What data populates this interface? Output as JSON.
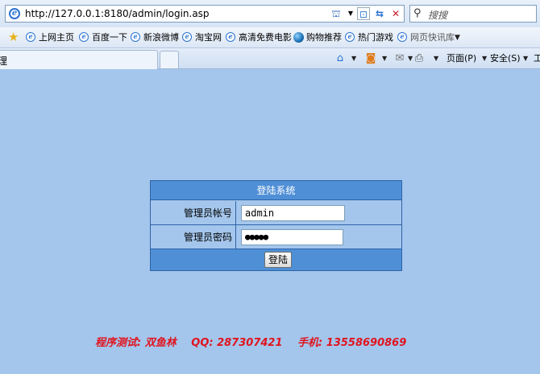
{
  "browser": {
    "url": "http://127.0.0.1:8180/admin/login.asp",
    "search_placeholder": "搜搜",
    "tab_label": "理",
    "favorites": [
      {
        "label": "上网主页",
        "icon": "ie-page-icon"
      },
      {
        "label": "百度一下",
        "icon": "ie-page-icon"
      },
      {
        "label": "新浪微博",
        "icon": "ie-page-icon"
      },
      {
        "label": "淘宝网",
        "icon": "ie-page-icon"
      },
      {
        "label": "高清免费电影",
        "icon": "ie-page-icon"
      },
      {
        "label": "购物推荐",
        "icon": "globe-icon"
      },
      {
        "label": "热门游戏",
        "icon": "ie-page-icon"
      },
      {
        "label": "网页快讯库",
        "icon": "ie-page-icon"
      }
    ],
    "commands": {
      "page": "页面(P)",
      "safety": "安全(S)",
      "tools": "工"
    }
  },
  "login": {
    "title": "登陆系统",
    "username_label": "管理员帐号",
    "username_value": "admin",
    "password_label": "管理员密码",
    "password_value": "●●●●●",
    "submit_label": "登陆"
  },
  "credits": {
    "tester": "程序测试: 双鱼林",
    "qq": "QQ: 287307421",
    "phone": "手机: 13558690869"
  },
  "colors": {
    "page_bg": "#a4c6ec",
    "header_bg": "#4f8fd6",
    "border": "#2d63a8",
    "credit_text": "#e0141e"
  }
}
